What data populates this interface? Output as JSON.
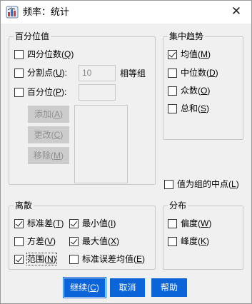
{
  "window": {
    "title": "频率：统计",
    "close_glyph": "✕"
  },
  "percentile": {
    "group_title": "百分位值",
    "quartiles": {
      "label": "四分位数(",
      "acc": "Q",
      "end": ")",
      "checked": false
    },
    "cutpoints": {
      "label": "分割点(",
      "acc": "U",
      "end": "):",
      "checked": false,
      "value": "10",
      "suffix": "相等组"
    },
    "percentiles": {
      "label": "百分位(",
      "acc": "P",
      "end": "):",
      "checked": false,
      "value": ""
    },
    "add_button": {
      "label": "添加(",
      "acc": "A",
      "end": ")"
    },
    "change_button": {
      "label": "更改(",
      "acc": "C",
      "end": ")"
    },
    "remove_button": {
      "label": "移除(",
      "acc": "M",
      "end": ")"
    }
  },
  "central": {
    "group_title": "集中趋势",
    "mean": {
      "label": "均值(",
      "acc": "M",
      "end": ")",
      "checked": true
    },
    "median": {
      "label": "中位数(",
      "acc": "D",
      "end": ")",
      "checked": false
    },
    "mode": {
      "label": "众数(",
      "acc": "O",
      "end": ")",
      "checked": false
    },
    "sum": {
      "label": "总和(",
      "acc": "S",
      "end": ")",
      "checked": false
    }
  },
  "midpoints": {
    "label": "值为组的中点(",
    "acc": "L",
    "end": ")",
    "checked": false
  },
  "dispersion": {
    "group_title": "离散",
    "stddev": {
      "label": "标准差(",
      "acc": "T",
      "end": ")",
      "checked": true
    },
    "minimum": {
      "label": "最小值(",
      "acc": "I",
      "end": ")",
      "checked": true
    },
    "variance": {
      "label": "方差(",
      "acc": "V",
      "end": ")",
      "checked": false
    },
    "maximum": {
      "label": "最大值(",
      "acc": "X",
      "end": ")",
      "checked": true
    },
    "range": {
      "label": "范围(",
      "acc": "N",
      "end": ")",
      "checked": true
    },
    "se_mean": {
      "label": "标准误差均值(",
      "acc": "E",
      "end": ")",
      "checked": false
    }
  },
  "distribution": {
    "group_title": "分布",
    "skewness": {
      "label": "偏度(",
      "acc": "W",
      "end": ")",
      "checked": false
    },
    "kurtosis": {
      "label": "峰度(",
      "acc": "K",
      "end": ")",
      "checked": false
    }
  },
  "footer": {
    "continue": {
      "label": "继续(",
      "acc": "C",
      "end": ")"
    },
    "cancel": {
      "label": "取消"
    },
    "help": {
      "label": "帮助"
    }
  },
  "colors": {
    "accent": "#0b64d8"
  }
}
